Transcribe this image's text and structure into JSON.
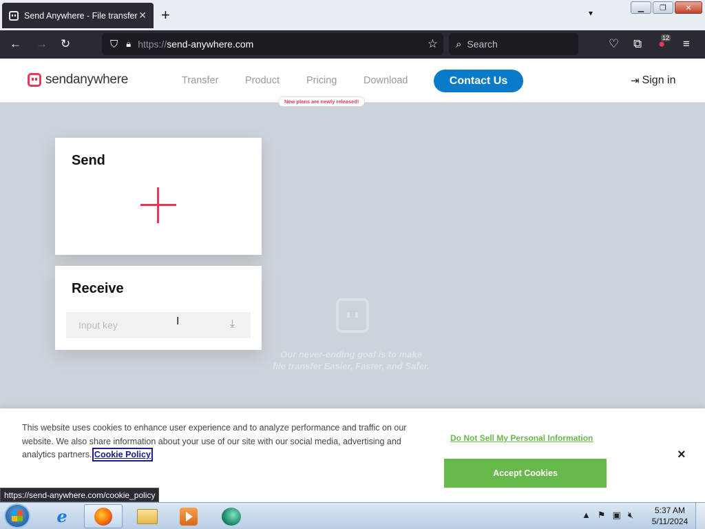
{
  "browser": {
    "tab_title": "Send Anywhere - File transfer",
    "new_tab_label": "+",
    "url_protocol": "https://",
    "url_host": "send-anywhere.com",
    "search_placeholder": "Search",
    "extension_badge": "12"
  },
  "site": {
    "logo_text": "sendanywhere",
    "nav": {
      "transfer": "Transfer",
      "product": "Product",
      "pricing": "Pricing",
      "download": "Download"
    },
    "pricing_badge": "New plans are newly released!",
    "contact_label": "Contact Us",
    "signin_label": "Sign in",
    "brand_color": "#e8385a",
    "accent_color": "#0a7bc9"
  },
  "send_card": {
    "title": "Send"
  },
  "receive_card": {
    "title": "Receive",
    "input_placeholder": "Input key"
  },
  "tagline": {
    "line1": "Our never-ending goal is to make",
    "line2": "file transfer Easier, Faster, and Safer."
  },
  "cookie_banner": {
    "text": "This website uses cookies to enhance user experience and to analyze performance and traffic on our website. We also share information about your use of our site with our social media, advertising and analytics partners.",
    "policy_link": "Cookie Policy",
    "do_not_sell": "Do Not Sell My Personal Information",
    "accept_label": "Accept Cookies",
    "close_label": "×",
    "accept_color": "#68b94b"
  },
  "status_url": "https://send-anywhere.com/cookie_policy",
  "taskbar": {
    "time": "5:37 AM",
    "date": "5/11/2024"
  }
}
